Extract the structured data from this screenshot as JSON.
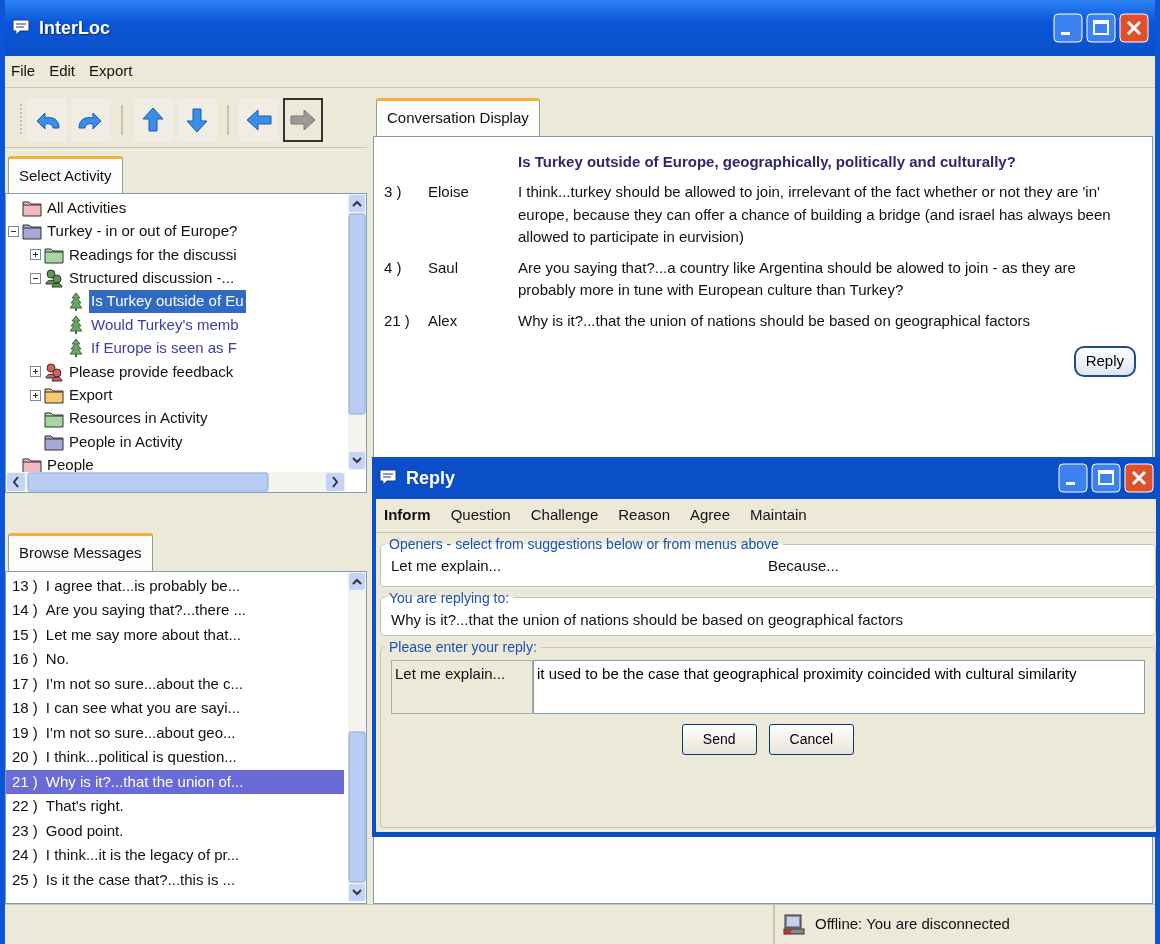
{
  "window": {
    "title": "InterLoc"
  },
  "menu": [
    "File",
    "Edit",
    "Export"
  ],
  "toolbar": [
    {
      "kind": "undo",
      "disabled": false
    },
    {
      "kind": "redo",
      "disabled": false
    },
    {
      "kind": "up",
      "disabled": false
    },
    {
      "kind": "down",
      "disabled": false
    },
    {
      "kind": "back",
      "disabled": false
    },
    {
      "kind": "forward",
      "disabled": true
    }
  ],
  "activity_panel": {
    "tab": "Select Activity",
    "tree": [
      {
        "label": "All Activities",
        "kind": "folder",
        "color": "#f4b8c0",
        "selected": false
      },
      {
        "label": "Turkey - in or out of Europe?",
        "kind": "folder",
        "color": "#a8a8d8",
        "expanded": true,
        "selected": false,
        "children": [
          {
            "label": "Readings for the discussi",
            "kind": "folder",
            "color": "#a8d8a0",
            "expanded": false,
            "selected": false
          },
          {
            "label": "Structured discussion -...",
            "kind": "discussion",
            "color": "#5a9a50",
            "expanded": true,
            "selected": false,
            "children": [
              {
                "label": "Is Turkey outside of Eu",
                "kind": "topic",
                "selected": true
              },
              {
                "label": "Would Turkey's memb",
                "kind": "topic",
                "selected": false
              },
              {
                "label": "If Europe is seen as F",
                "kind": "topic",
                "selected": false
              }
            ]
          },
          {
            "label": "Please provide feedback",
            "kind": "discussion",
            "color": "#d86060",
            "expanded": false,
            "selected": false
          },
          {
            "label": "Export",
            "kind": "folder",
            "color": "#f8c870",
            "expanded": false,
            "selected": false
          },
          {
            "label": "Resources in Activity",
            "kind": "folder",
            "color": "#a8d8a0",
            "selected": false
          },
          {
            "label": "People in Activity",
            "kind": "folder",
            "color": "#a8a8d8",
            "selected": false
          }
        ]
      },
      {
        "label": "People",
        "kind": "folder",
        "color": "#f4b8c0",
        "selected": false
      }
    ]
  },
  "messages_panel": {
    "tab": "Browse Messages",
    "items": [
      {
        "number": "13 )",
        "text": "I agree that...is probably be...",
        "selected": false
      },
      {
        "number": "14 )",
        "text": "Are you saying that?...there ...",
        "selected": false
      },
      {
        "number": "15 )",
        "text": "Let me say more about that...",
        "selected": false
      },
      {
        "number": "16 )",
        "text": "No.",
        "selected": false
      },
      {
        "number": "17 )",
        "text": "I'm not so sure...about the c...",
        "selected": false
      },
      {
        "number": "18 )",
        "text": "I can see what you are sayi...",
        "selected": false
      },
      {
        "number": "19 )",
        "text": "I'm not so sure...about geo...",
        "selected": false
      },
      {
        "number": "20 )",
        "text": "I think...political is question...",
        "selected": false
      },
      {
        "number": "21 )",
        "text": "Why is it?...that the union of...",
        "selected": true
      },
      {
        "number": "22 )",
        "text": "That's right.",
        "selected": false
      },
      {
        "number": "23 )",
        "text": "Good point.",
        "selected": false
      },
      {
        "number": "24 )",
        "text": "I think...it is the legacy of pr...",
        "selected": false
      },
      {
        "number": "25 )",
        "text": "Is it the case that?...this is ...",
        "selected": false
      }
    ]
  },
  "conversation": {
    "tab": "Conversation Display",
    "question": "Is Turkey outside of Europe, geographically, politically and culturally?",
    "messages": [
      {
        "number": "3 )",
        "author": "Eloise",
        "text": "I think...turkey should be allowed to join, irrelevant of the fact whether or not they are 'in' europe, because they can offer a chance of building a bridge (and israel has always been allowed to participate in eurvision)"
      },
      {
        "number": "4 )",
        "author": "Saul",
        "text": "Are you saying that?...a country like Argentina should be alowed to join - as they are probably more in tune with European culture than Turkey?"
      },
      {
        "number": "21 )",
        "author": "Alex",
        "text": "Why is it?...that the union of nations should be based on geographical factors"
      }
    ],
    "reply_button": "Reply"
  },
  "reply_window": {
    "title": "Reply",
    "categories": [
      {
        "label": "Inform",
        "selected": true
      },
      {
        "label": "Question",
        "selected": false
      },
      {
        "label": "Challenge",
        "selected": false
      },
      {
        "label": "Reason",
        "selected": false
      },
      {
        "label": "Agree",
        "selected": false
      },
      {
        "label": "Maintain",
        "selected": false
      }
    ],
    "openers": {
      "legend": "Openers - select from suggestions below or from menus above",
      "items": [
        "Let me explain...",
        "Because..."
      ]
    },
    "replying_to": {
      "legend": "You are replying to:",
      "text": "Why is it?...that the union of nations should be based on geographical factors"
    },
    "entry": {
      "legend": "Please enter your reply:",
      "opener": "Let me explain...",
      "value": "it used to be the case that geographical proximity coincided with cultural similarity"
    },
    "buttons": [
      "Send",
      "Cancel"
    ]
  },
  "status_bar": {
    "text": "Offline: You are disconnected"
  }
}
